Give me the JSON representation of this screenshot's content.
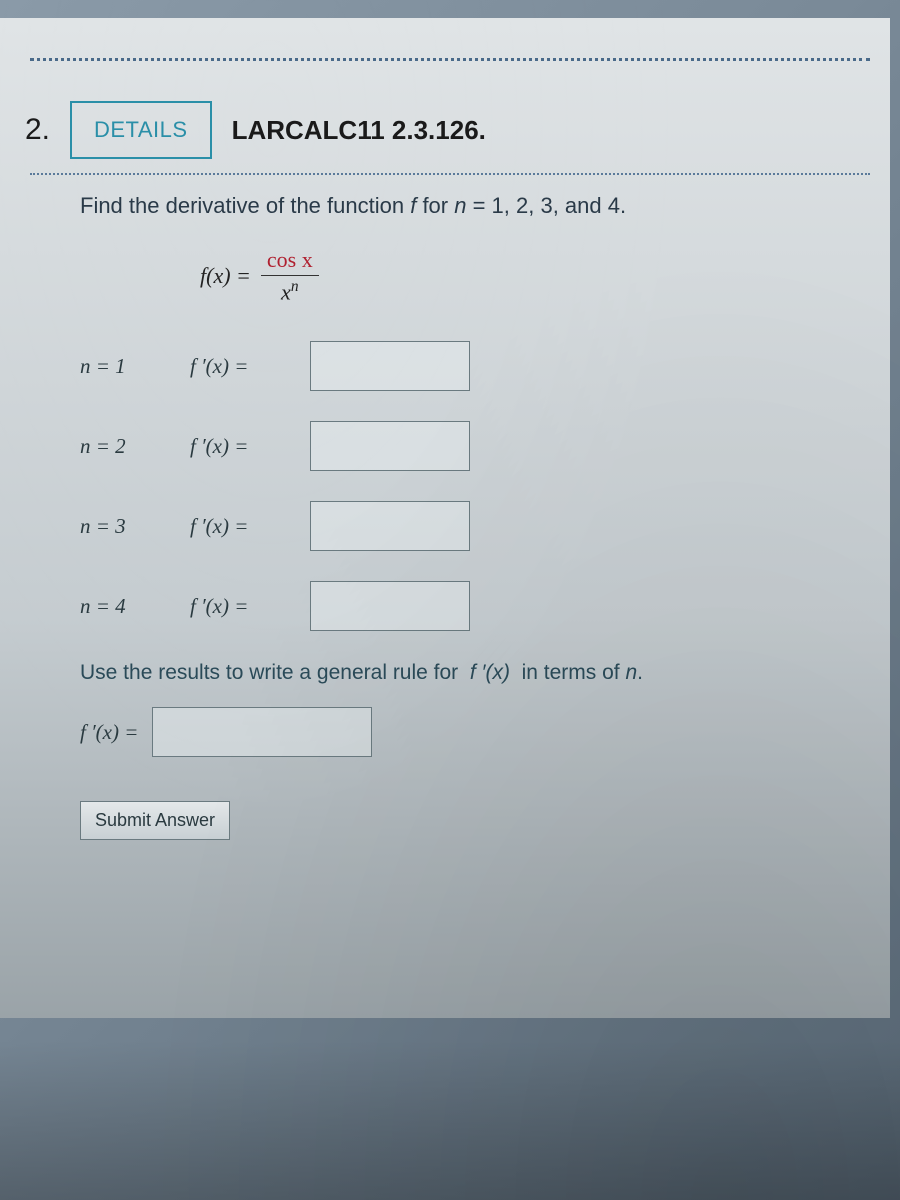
{
  "question_number": "2.",
  "details_label": "DETAILS",
  "question_code": "LARCALC11 2.3.126.",
  "prompt_html": "Find the derivative of the function f for n = 1, 2, 3, and 4.",
  "formula": {
    "lhs": "f(x) =",
    "numerator": "cos x",
    "denominator_base": "x",
    "denominator_exp": "n"
  },
  "rows": [
    {
      "n_label": "n = 1",
      "f_label": "f ′(x) =",
      "value": ""
    },
    {
      "n_label": "n = 2",
      "f_label": "f ′(x) =",
      "value": ""
    },
    {
      "n_label": "n = 3",
      "f_label": "f ′(x) =",
      "value": ""
    },
    {
      "n_label": "n = 4",
      "f_label": "f ′(x) =",
      "value": ""
    }
  ],
  "prompt2": "Use the results to write a general rule for  f ′(x)  in terms of n.",
  "general": {
    "label": "f ′(x) =",
    "value": ""
  },
  "submit_label": "Submit Answer"
}
